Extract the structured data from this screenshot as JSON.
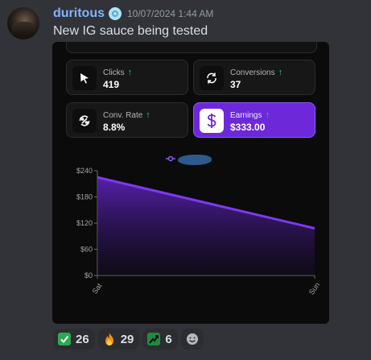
{
  "message": {
    "username": "duritous",
    "timestamp": "10/07/2024 1:44 AM",
    "text": "New IG sauce being tested"
  },
  "stats": [
    {
      "label": "Clicks",
      "value": "419",
      "icon": "cursor-icon"
    },
    {
      "label": "Conversions",
      "value": "37",
      "icon": "refresh-icon"
    },
    {
      "label": "Conv. Rate",
      "value": "8.8%",
      "icon": "percent-icon"
    },
    {
      "label": "Earnings",
      "value": "$333.00",
      "icon": "dollar-icon"
    }
  ],
  "chart_data": {
    "type": "area",
    "x": [
      "Sat",
      "Sun"
    ],
    "series": [
      {
        "values": [
          225,
          108
        ]
      }
    ],
    "yticks": [
      "$240",
      "$180",
      "$120",
      "$60",
      "$0"
    ],
    "ylim": [
      0,
      240
    ],
    "grid": false,
    "color": "#7c3aed"
  },
  "reactions": [
    {
      "emoji": "check-mark-icon",
      "count": "26"
    },
    {
      "emoji": "fire-icon",
      "count": "29"
    },
    {
      "emoji": "chart-up-icon",
      "count": "6"
    },
    {
      "emoji": "add-reaction-icon",
      "count": ""
    }
  ],
  "colors": {
    "accent": "#7c3aed",
    "username": "#7fb4ff",
    "up_arrow": "#2ecc71"
  }
}
